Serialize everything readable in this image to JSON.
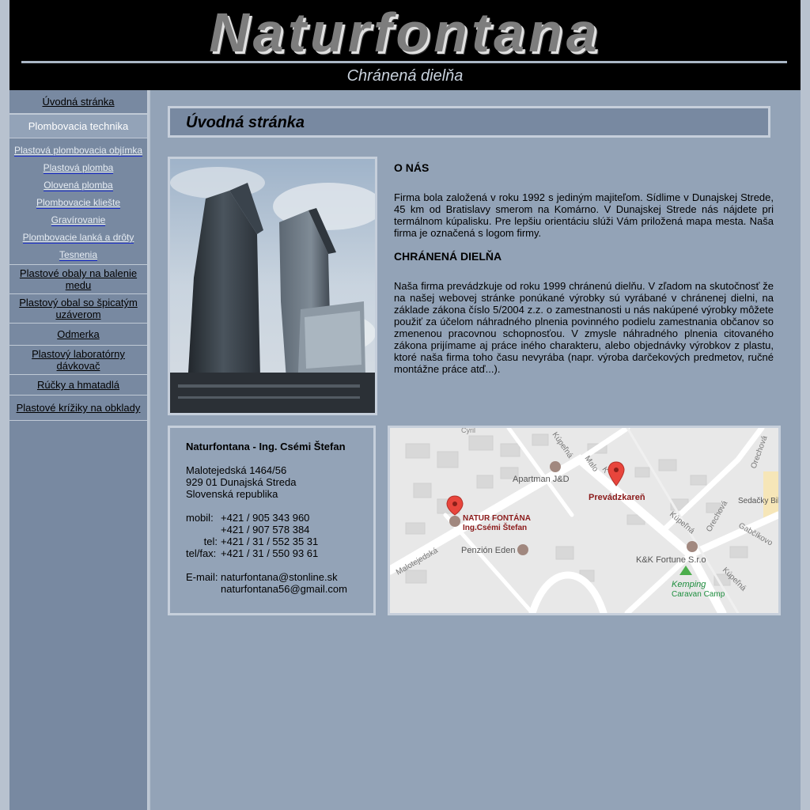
{
  "header": {
    "logo_text": "Naturfontana",
    "tagline": "Chránená dielňa"
  },
  "sidebar": {
    "items": [
      {
        "label": "Úvodná stránka"
      },
      {
        "label": "Plombovacia technika"
      },
      {
        "label": "Plastová plombovacia objímka"
      },
      {
        "label": "Plastová plomba"
      },
      {
        "label": "Olovená plomba"
      },
      {
        "label": "Plombovacie kliešte"
      },
      {
        "label": "Gravírovanie"
      },
      {
        "label": "Plombovacie lanká a drôty"
      },
      {
        "label": "Tesnenia"
      },
      {
        "label": "Plastové obaly na balenie medu"
      },
      {
        "label": "Plastový obal so špicatým uzáverom"
      },
      {
        "label": "Odmerka"
      },
      {
        "label": "Plastový laboratórny dávkovač"
      },
      {
        "label": "Rúčky a hmatadlá"
      },
      {
        "label": "Plastové krížiky na obklady"
      }
    ]
  },
  "main": {
    "page_title": "Úvodná stránka",
    "about_heading": "O NÁS",
    "about_text": "Firma bola založená v roku 1992 s jediným majiteľom. Sídlime v Dunajskej Strede, 45 km od Bratislavy smerom na Komárno. V Dunajskej Strede nás nájdete pri termálnom kúpalisku. Pre lepšiu orientáciu slúži Vám priložená mapa mesta. Naša firma je označená s logom firmy.",
    "workshop_heading": "CHRÁNENÁ DIELŇA",
    "workshop_text": "Naša firma prevádzkuje od roku 1999 chránenú dielňu. V zľadom na skutočnosť že na našej webovej stránke ponúkané výrobky sú vyrábané v chránenej dielni, na základe zákona číslo 5/2004 z.z. o zamestnanosti u nás nakúpené výrobky môžete použiť za účelom náhradného plnenia povinného podielu zamestnania občanov so zmenenou pracovnou schopnosťou. V zmysle náhradného plnenia citovaného zákona prijímame aj práce iného charakteru, alebo objednávky výrobkov z plastu, ktoré naša firma toho času nevyrába (napr. výroba darčekových predmetov, ručné montážne práce atď...)."
  },
  "contact": {
    "company": "Naturfontana - Ing. Csémi Štefan",
    "street": "Malotejedská 1464/56",
    "city": "929 01 Dunajská Streda",
    "country": "Slovenská republika",
    "mobile_label": "mobil:",
    "mobile_1": "+421 / 905 343 960",
    "mobile_2": "+421 / 907 578 384",
    "tel_label": "tel:",
    "tel": "+421 / 31 / 552 35 31",
    "telfax_label": "tel/fax:",
    "telfax": "+421 / 31 / 550 93 61",
    "email_label": "E-mail:",
    "email_1": "naturfontana@stonline.sk",
    "email_2": "naturfontana56@gmail.com"
  },
  "map": {
    "labels": {
      "apartman": "Apartman J&D",
      "prevadzkaren": "Prevádzkareň",
      "natur_1": "NATUR FONTÁNA",
      "natur_2": "Ing.Csémi Štefan",
      "penzion": "Penzión Eden",
      "kk": "K&K Fortune S.r.o",
      "kemping_1": "Kemping",
      "kemping_2": "Caravan Camp",
      "sedacky": "Sedačky Bill",
      "street_malotejedska": "Malotejedská",
      "street_kupelna_1": "Kúpeľná",
      "street_kupelna_2": "Kúpeľná",
      "street_orechova_1": "Orechová",
      "street_orechova_2": "Orechová",
      "street_gabcikovo": "Gabčíkovo",
      "street_malo": "Malo",
      "street_k": "K",
      "street_kupelna_3": "Kúpeľná",
      "street_top": "Cyril"
    },
    "colors": {
      "pin": "#e8453c",
      "label_red": "#8b1a1a",
      "kemping": "#1e8e3e"
    }
  }
}
